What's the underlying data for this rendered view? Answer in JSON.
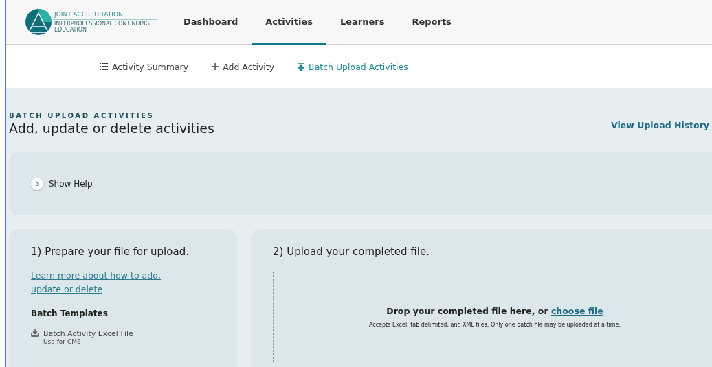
{
  "logo": {
    "title": "JOINT ACCREDITATION",
    "subtitle": "INTERPROFESSIONAL CONTINUING EDUCATION"
  },
  "nav": [
    {
      "label": "Dashboard",
      "selected": false
    },
    {
      "label": "Activities",
      "selected": true
    },
    {
      "label": "Learners",
      "selected": false
    },
    {
      "label": "Reports",
      "selected": false
    }
  ],
  "subnav": [
    {
      "label": "Activity Summary",
      "kind": "list",
      "selected": false
    },
    {
      "label": "Add Activity",
      "kind": "plus",
      "selected": false
    },
    {
      "label": "Batch Upload Activities",
      "kind": "upload",
      "selected": true
    }
  ],
  "page": {
    "eyebrow": "BATCH UPLOAD ACTIVITIES",
    "title": "Add, update or delete activities",
    "history_link": "View Upload History"
  },
  "help": {
    "label": "Show Help",
    "expanded": false
  },
  "prepare": {
    "title": "1) Prepare your file for upload.",
    "link": "Learn more about how to add, update or delete",
    "templates_heading": "Batch Templates",
    "templates": [
      {
        "name": "Batch Activity Excel File",
        "note": "Use for CME"
      }
    ]
  },
  "upload": {
    "title": "2) Upload your completed file.",
    "drop_text": "Drop your completed file here, or",
    "choose_link": "choose file",
    "hint": "Accepts Excel, tab delimited, and XML files. Only one batch file may be uploaded at a time."
  }
}
